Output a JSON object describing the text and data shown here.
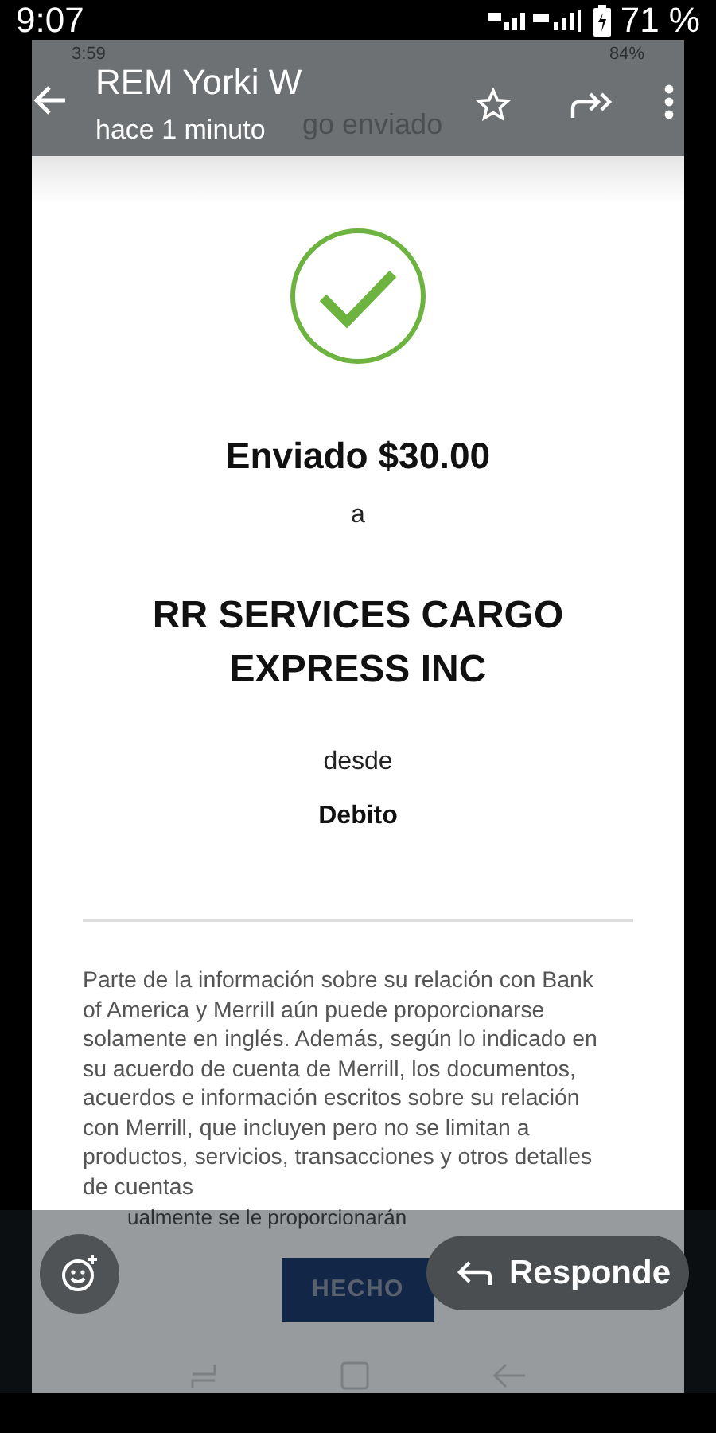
{
  "status_bar": {
    "time": "9:07",
    "battery": "71 %"
  },
  "inner_status_bar": {
    "time": "3:59",
    "battery": "84%"
  },
  "header": {
    "title": "REM Yorki W",
    "subtitle": "hace 1 minuto"
  },
  "screenshot": {
    "title": "go enviado",
    "amount_line": "Enviado $30.00",
    "to_word": "a",
    "recipient": "RR SERVICES CARGO EXPRESS INC",
    "from_word": "desde",
    "account": "Debito",
    "disclaimer": "Parte de la información sobre su relación con Bank of America y Merrill aún puede proporcionarse solamente en inglés. Además, según lo indicado en su acuerdo de cuenta de Merrill, los documentos, acuerdos e información escritos sobre su relación con Merrill, que incluyen pero no se limitan a productos, servicios, transacciones y otros detalles de cuentas",
    "disclaimer_last_line": "ualmente se le proporcionarán",
    "done_button": "HECHO"
  },
  "reply_button": "Responde"
}
